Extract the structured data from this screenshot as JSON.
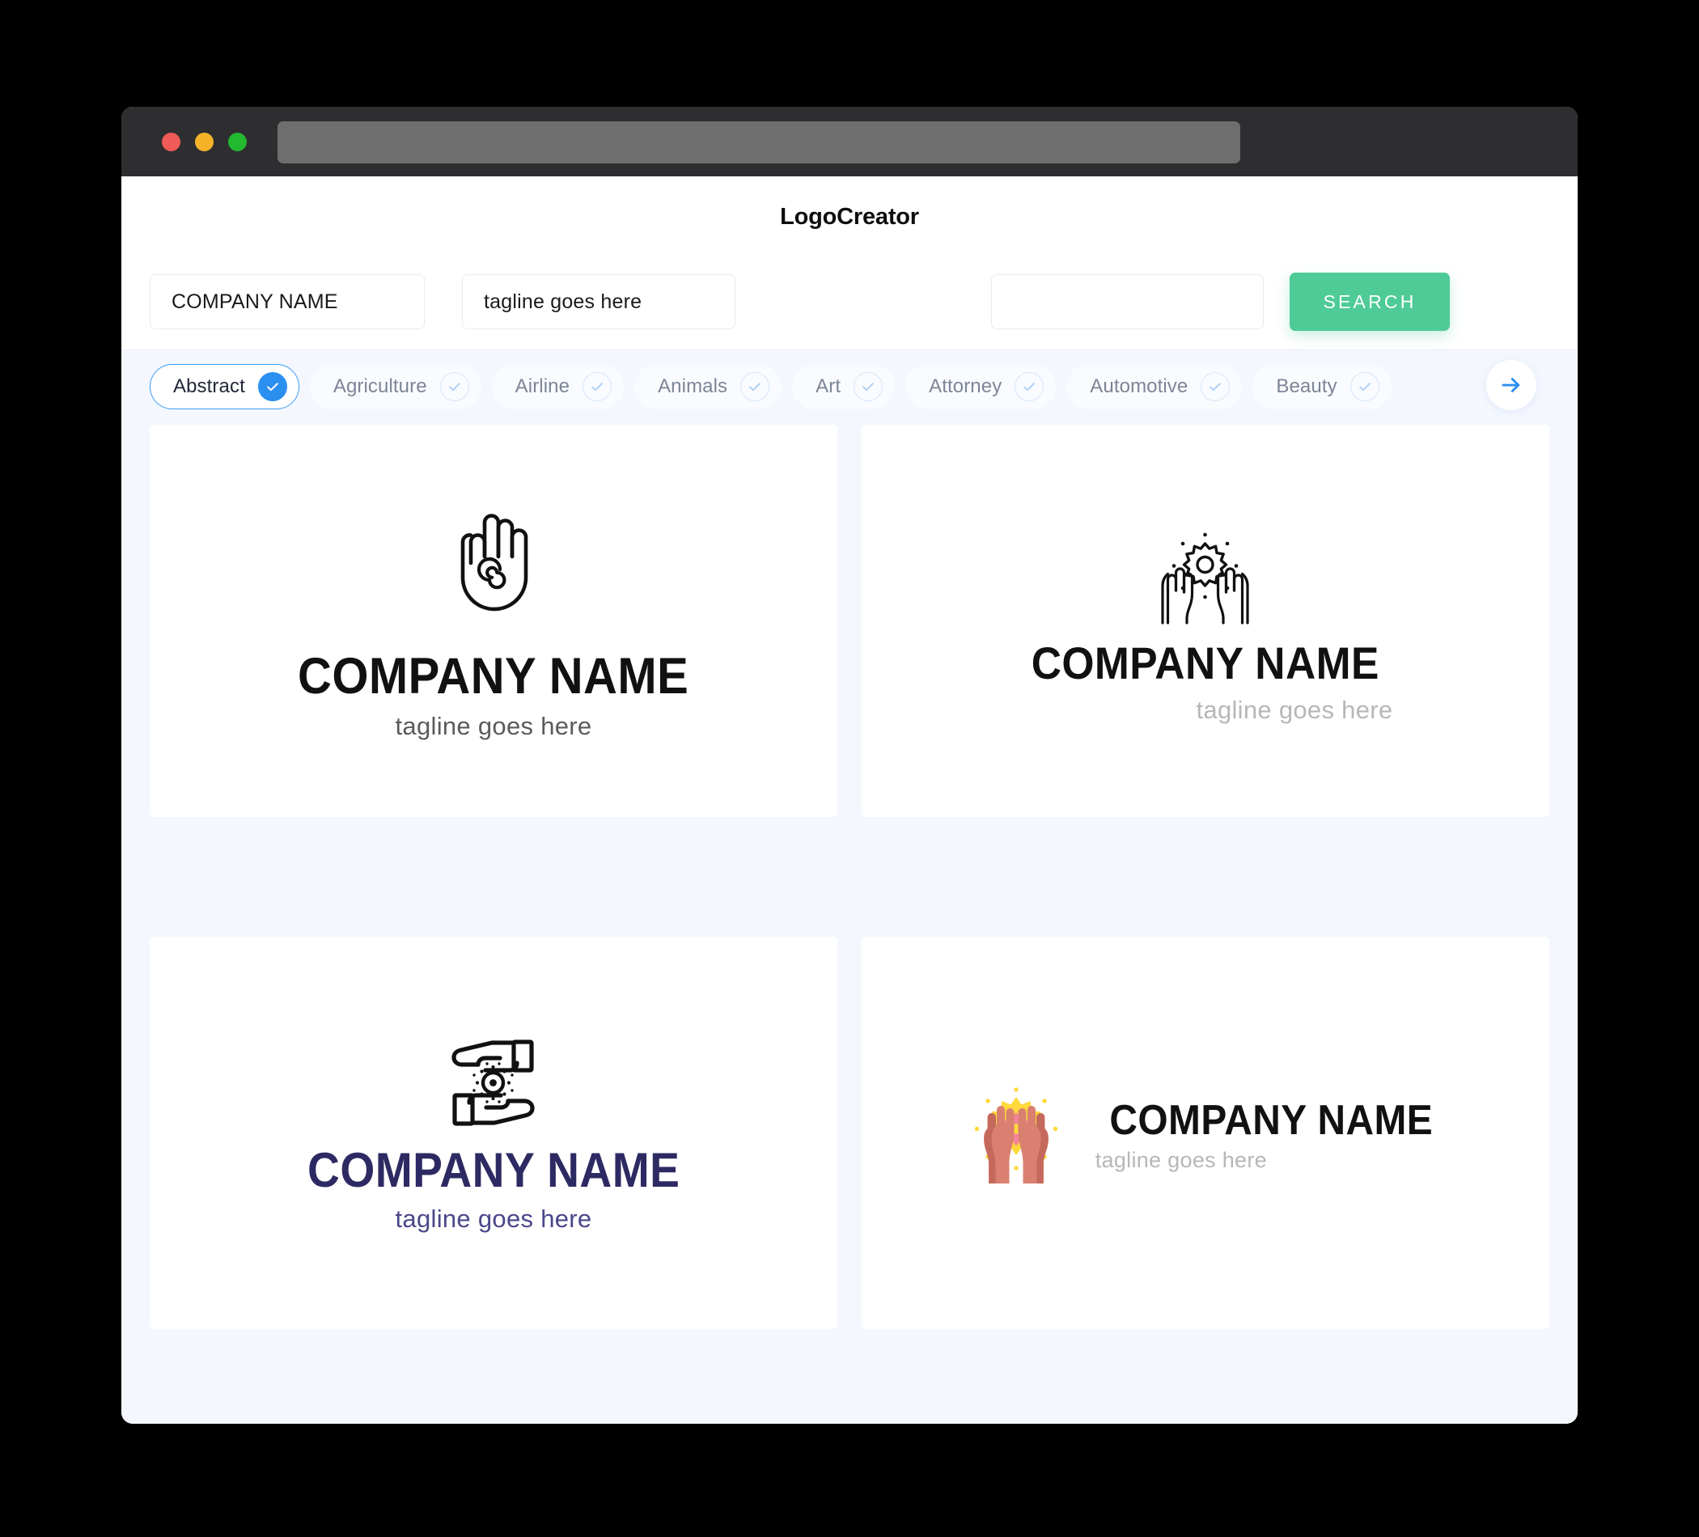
{
  "window": {
    "titlebar": {
      "lights": [
        "close-red",
        "minimize-yellow",
        "maximize-green"
      ],
      "address_value": ""
    }
  },
  "header": {
    "title": "LogoCreator"
  },
  "search": {
    "company_value": "COMPANY NAME",
    "company_placeholder": "COMPANY NAME",
    "tagline_value": "tagline goes here",
    "tagline_placeholder": "tagline goes here",
    "extra_value": "",
    "extra_placeholder": "",
    "button_label": "SEARCH",
    "button_color": "#4ECB97"
  },
  "categories": {
    "next_icon": "arrow-right-icon",
    "active_color": "#2B8FF0",
    "items": [
      {
        "label": "Abstract",
        "selected": true
      },
      {
        "label": "Agriculture",
        "selected": false
      },
      {
        "label": "Airline",
        "selected": false
      },
      {
        "label": "Animals",
        "selected": false
      },
      {
        "label": "Art",
        "selected": false
      },
      {
        "label": "Attorney",
        "selected": false
      },
      {
        "label": "Automotive",
        "selected": false
      },
      {
        "label": "Beauty",
        "selected": false
      }
    ]
  },
  "results": {
    "cards": [
      {
        "mark": "hand-spiral-icon",
        "name": "COMPANY NAME",
        "tagline": "tagline goes here",
        "name_color": "#111111",
        "tagline_color": "#5B5B5B",
        "layout": "stacked"
      },
      {
        "mark": "hands-holding-sun-icon",
        "name": "COMPANY NAME",
        "tagline": "tagline goes here",
        "name_color": "#111111",
        "tagline_color": "#B7B7B7",
        "layout": "stacked"
      },
      {
        "mark": "two-hands-radiant-circle-icon",
        "name": "COMPANY NAME",
        "tagline": "tagline goes here",
        "name_color": "#2D2A63",
        "tagline_color": "#4A4789",
        "layout": "stacked"
      },
      {
        "mark": "color-hands-sun-icon",
        "name": "COMPANY NAME",
        "tagline": "tagline goes here",
        "name_color": "#111111",
        "tagline_color": "#B7B7B7",
        "layout": "inline",
        "palette": {
          "hand": "#D98070",
          "hand_shade": "#C4695C",
          "sun": "#FFD83B",
          "sun_center": "#F4849A"
        }
      }
    ]
  }
}
